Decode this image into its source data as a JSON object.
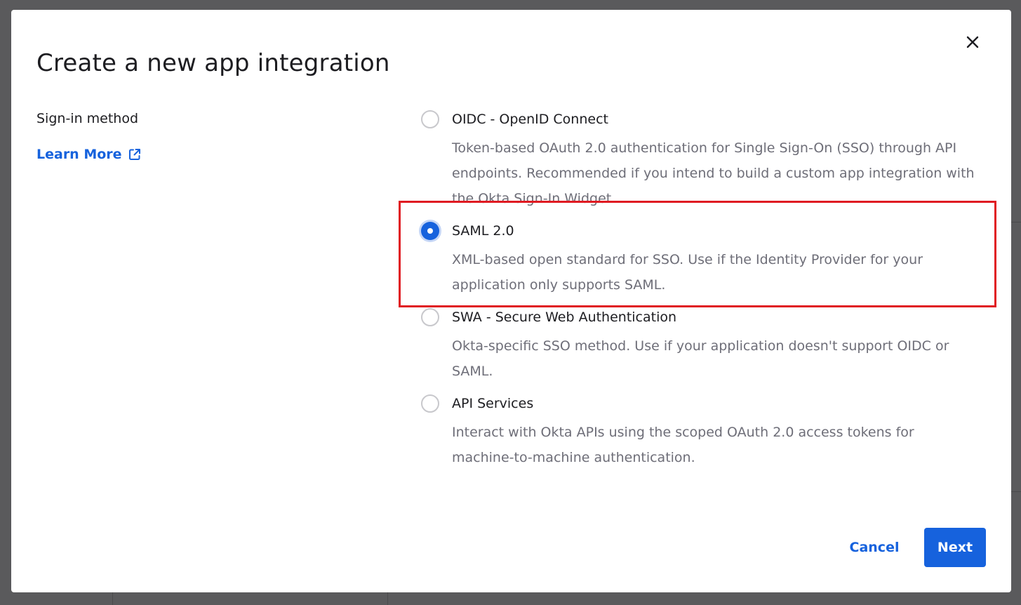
{
  "dialog": {
    "title": "Create a new app integration",
    "close_icon": "close-icon"
  },
  "sign_in": {
    "label": "Sign-in method",
    "learn_more": "Learn More",
    "learn_more_icon": "external-link-icon"
  },
  "options": [
    {
      "label": "OIDC - OpenID Connect",
      "description": "Token-based OAuth 2.0 authentication for Single Sign-On (SSO) through API endpoints. Recommended if you intend to build a custom app integration with the Okta Sign-In Widget.",
      "selected": false
    },
    {
      "label": "SAML 2.0",
      "description": "XML-based open standard for SSO. Use if the Identity Provider for your application only supports SAML.",
      "selected": true
    },
    {
      "label": "SWA - Secure Web Authentication",
      "description": "Okta-specific SSO method. Use if your application doesn't support OIDC or SAML.",
      "selected": false
    },
    {
      "label": "API Services",
      "description": "Interact with Okta APIs using the scoped OAuth 2.0 access tokens for machine-to-machine authentication.",
      "selected": false
    }
  ],
  "footer": {
    "cancel_label": "Cancel",
    "next_label": "Next"
  },
  "colors": {
    "accent": "#1662dd",
    "highlight": "#e01b22",
    "backdrop": "#5a5a5c"
  }
}
